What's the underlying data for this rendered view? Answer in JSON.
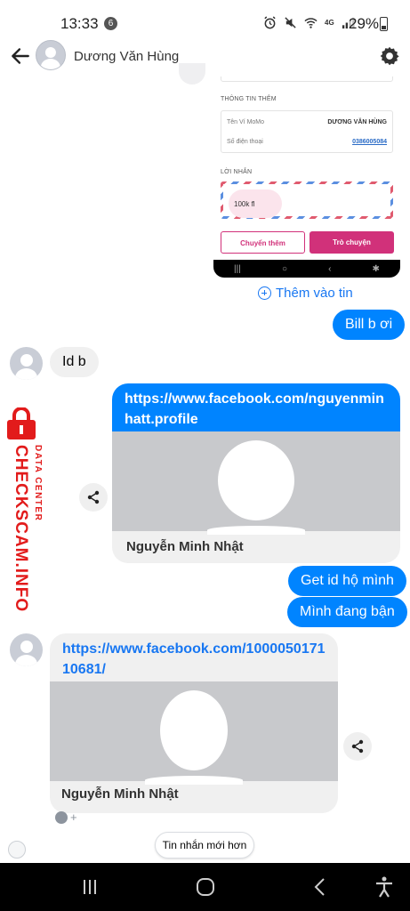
{
  "status_bar": {
    "time": "13:33",
    "notification_count": "6",
    "network": "4G",
    "battery": "29%"
  },
  "header": {
    "contact_name": "Dương Văn Hùng"
  },
  "shared_screenshot": {
    "section_more_info": "THÔNG TIN THÊM",
    "wallet_name_label": "Tên Ví MoMo",
    "wallet_name_value": "DƯƠNG VĂN HÙNG",
    "phone_label": "Số điện thoại",
    "phone_value": "0386005084",
    "message_section": "LỜI NHẮN",
    "message_text": "100k fl",
    "transfer_more_button": "Chuyển thêm",
    "chat_button": "Trò chuyện"
  },
  "add_to_story": "Thêm vào tin",
  "messages": {
    "out_bill": "Bill b ơi",
    "in_id": "Id b",
    "link1_url": "https://www.facebook.com/nguyenminhatt.profile",
    "link1_title": "Nguyễn Minh Nhật",
    "out_get_id": "Get id hộ mình",
    "out_busy": "Mình đang bận",
    "link2_url": "https://www.facebook.com/100005017110681/",
    "link2_title": "Nguyễn Minh Nhật"
  },
  "newer_messages_button": "Tin nhắn mới hơn",
  "watermark": {
    "small": "DATA CENTER",
    "big": "CHECKSCAM.INFO"
  },
  "colors": {
    "messenger_blue": "#0084ff",
    "incoming_bubble": "#f0f0f0",
    "momo_pink": "#d1317a",
    "watermark_red": "#e21b1b"
  }
}
